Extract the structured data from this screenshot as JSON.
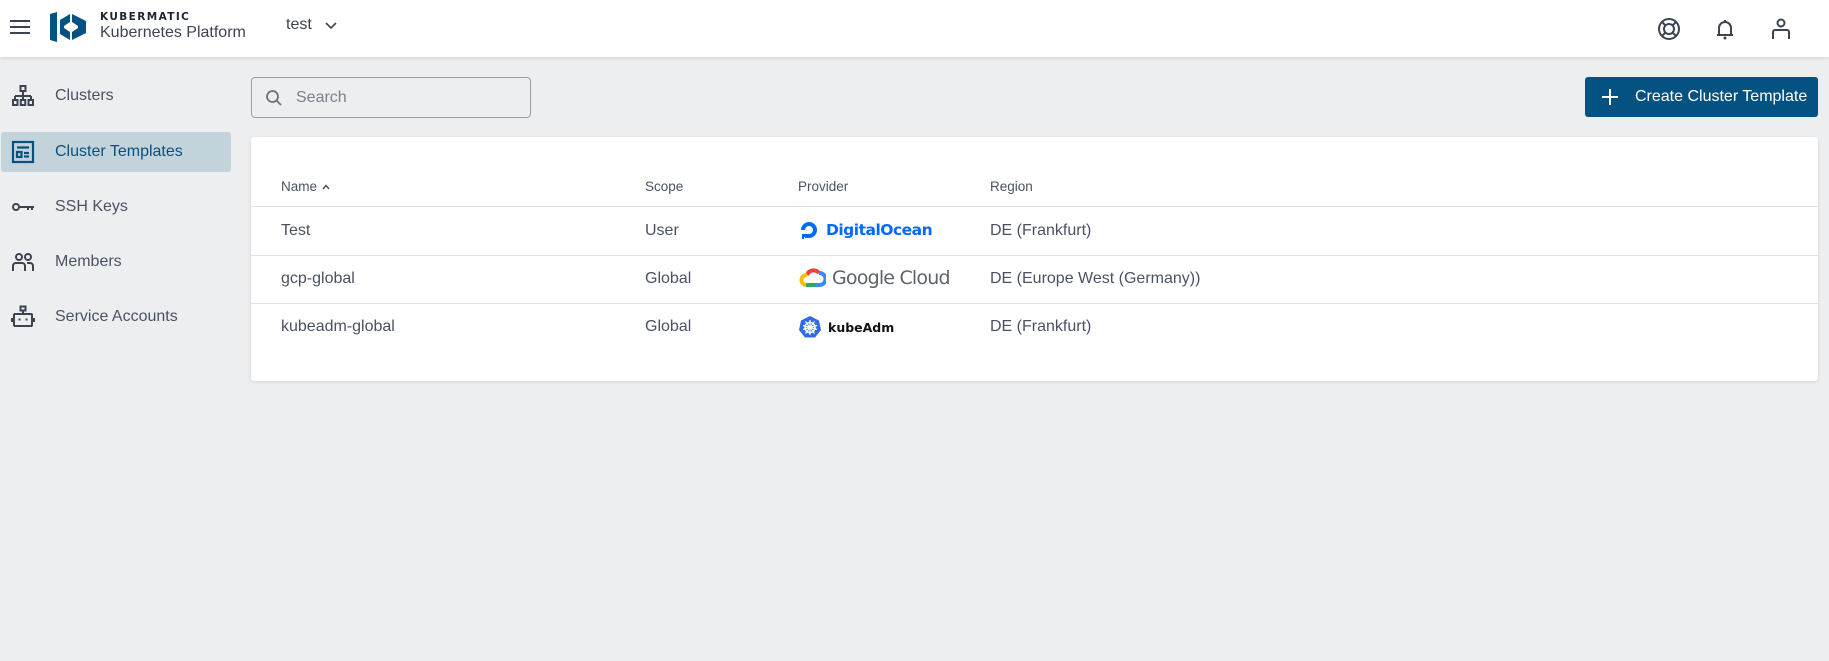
{
  "header": {
    "brand_small": "KUBERMATIC",
    "brand_title": "Kubernetes Platform",
    "project": "test",
    "icons": [
      "help-lifebuoy-icon",
      "notifications-bell-icon",
      "account-user-icon"
    ]
  },
  "sidebar": {
    "items": [
      {
        "label": "Clusters",
        "icon": "clusters-hierarchy-icon",
        "active": false
      },
      {
        "label": "Cluster Templates",
        "icon": "cluster-templates-icon",
        "active": true
      },
      {
        "label": "SSH Keys",
        "icon": "key-icon",
        "active": false
      },
      {
        "label": "Members",
        "icon": "members-icon",
        "active": false
      },
      {
        "label": "Service Accounts",
        "icon": "robot-icon",
        "active": false
      }
    ]
  },
  "toolbar": {
    "search_placeholder": "Search",
    "search_value": "",
    "create_label": "Create Cluster Template"
  },
  "table": {
    "columns": {
      "name": "Name",
      "name_sort": "ascending",
      "scope": "Scope",
      "provider": "Provider",
      "region": "Region"
    },
    "rows": [
      {
        "name": "Test",
        "scope": "User",
        "provider": "DigitalOcean",
        "provider_icon": "digitalocean-logo-icon",
        "region": "DE (Frankfurt)"
      },
      {
        "name": "gcp-global",
        "scope": "Global",
        "provider": "Google Cloud",
        "provider_icon": "google-cloud-logo-icon",
        "region": "DE (Europe West (Germany))"
      },
      {
        "name": "kubeadm-global",
        "scope": "Global",
        "provider": "kubeAdm",
        "provider_icon": "kubeadm-logo-icon",
        "region": "DE (Frankfurt)"
      }
    ]
  },
  "colors": {
    "primary": "#045281",
    "active_nav_bg": "#c2d3dc",
    "page_bg": "#edeef0",
    "digitalocean": "#0069ff",
    "kubernetes": "#326ce5"
  }
}
